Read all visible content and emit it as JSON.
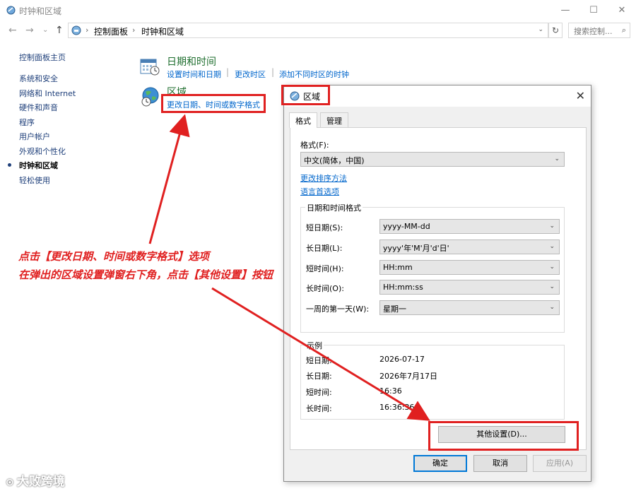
{
  "window": {
    "title": "时钟和区域",
    "minimize": "—",
    "maximize": "☐",
    "close": "✕"
  },
  "nav": {
    "back": "←",
    "forward": "→",
    "recent": "⌄",
    "up": "↑"
  },
  "address": {
    "crumbs": [
      "控制面板",
      "时钟和区域"
    ],
    "sep": "›",
    "dropdown": "⌄",
    "refresh": "↻"
  },
  "search": {
    "placeholder": "搜索控制...",
    "icon": "⌕"
  },
  "sidebar": {
    "items": [
      {
        "label": "控制面板主页"
      },
      {
        "label": "系统和安全"
      },
      {
        "label": "网络和 Internet"
      },
      {
        "label": "硬件和声音"
      },
      {
        "label": "程序"
      },
      {
        "label": "用户帐户"
      },
      {
        "label": "外观和个性化"
      },
      {
        "label": "时钟和区域",
        "active": true
      },
      {
        "label": "轻松使用"
      }
    ]
  },
  "categories": {
    "datetime": {
      "title": "日期和时间",
      "links": [
        "设置时间和日期",
        "更改时区",
        "添加不同时区的时钟"
      ]
    },
    "region": {
      "title": "区域",
      "links": [
        "更改日期、时间或数字格式"
      ]
    }
  },
  "dialog": {
    "title": "区域",
    "close": "✕",
    "tabs": [
      "格式",
      "管理"
    ],
    "format_label": "格式(F):",
    "format_value": "中文(简体，中国)",
    "links": [
      "更改排序方法",
      "语言首选项"
    ],
    "dt_group": "日期和时间格式",
    "fields": [
      {
        "label": "短日期(S):",
        "value": "yyyy-MM-dd"
      },
      {
        "label": "长日期(L):",
        "value": "yyyy'年'M'月'd'日'"
      },
      {
        "label": "短时间(H):",
        "value": "HH:mm"
      },
      {
        "label": "长时间(O):",
        "value": "HH:mm:ss"
      },
      {
        "label": "一周的第一天(W):",
        "value": "星期一"
      }
    ],
    "examples_group": "示例",
    "examples": [
      {
        "label": "短日期:",
        "value": "2026-07-17"
      },
      {
        "label": "长日期:",
        "value": "2026年7月17日"
      },
      {
        "label": "短时间:",
        "value": "16:36"
      },
      {
        "label": "长时间:",
        "value": "16:36:36"
      }
    ],
    "other_settings": "其他设置(D)...",
    "ok": "确定",
    "cancel": "取消",
    "apply": "应用(A)"
  },
  "annotation": {
    "line1": "点击【更改日期、时间或数字格式】选项",
    "line2": "在弹出的区域设置弹窗右下角，点击【其他设置】按钮",
    "color": "#e02020"
  },
  "watermark": "大败跨境",
  "colors": {
    "link": "#0066cc",
    "category_title": "#1e6e2e",
    "sidebar_link": "#1e3f7a",
    "dialog_bg": "#f0f0f0"
  }
}
